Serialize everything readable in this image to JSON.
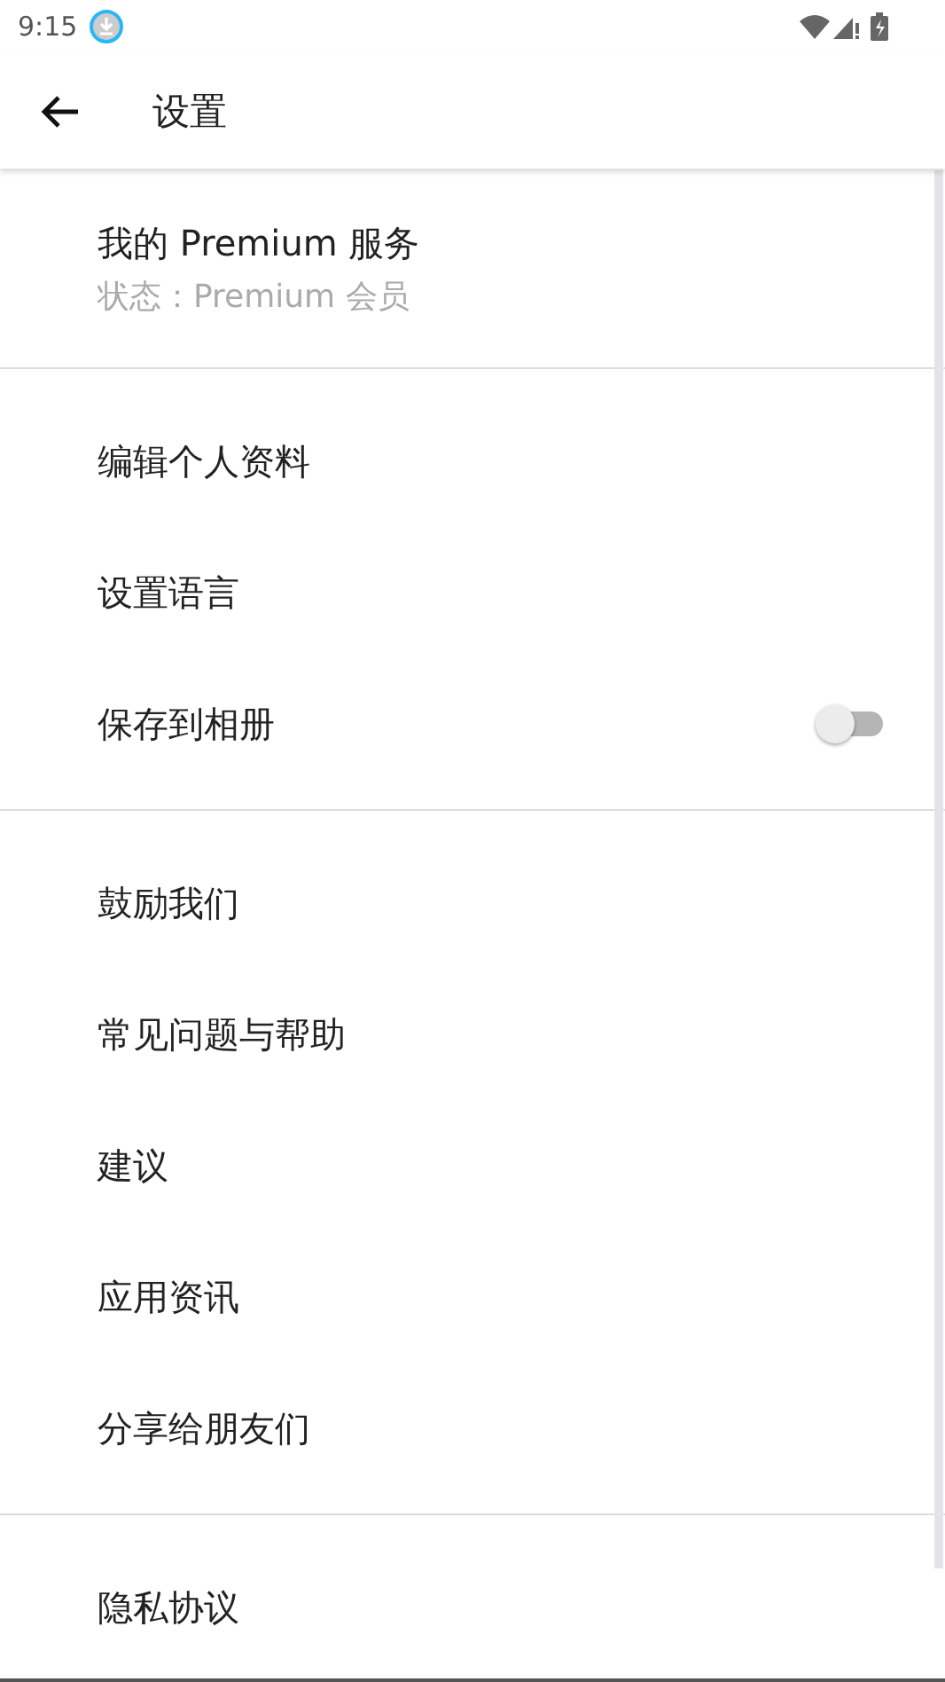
{
  "status_bar": {
    "time": "9:15"
  },
  "app_bar": {
    "title": "设置"
  },
  "premium": {
    "title": "我的 Premium 服务",
    "subtitle": "状态：Premium 会员"
  },
  "sections": [
    {
      "items": [
        {
          "kind": "link",
          "label": "编辑个人资料"
        },
        {
          "kind": "link",
          "label": "设置语言"
        },
        {
          "kind": "toggle",
          "label": "保存到相册",
          "on": false
        }
      ]
    },
    {
      "items": [
        {
          "kind": "link",
          "label": "鼓励我们"
        },
        {
          "kind": "link",
          "label": "常见问题与帮助"
        },
        {
          "kind": "link",
          "label": "建议"
        },
        {
          "kind": "link",
          "label": "应用资讯"
        },
        {
          "kind": "link",
          "label": "分享给朋友们"
        }
      ]
    },
    {
      "items": [
        {
          "kind": "link",
          "label": "隐私协议"
        }
      ]
    }
  ]
}
